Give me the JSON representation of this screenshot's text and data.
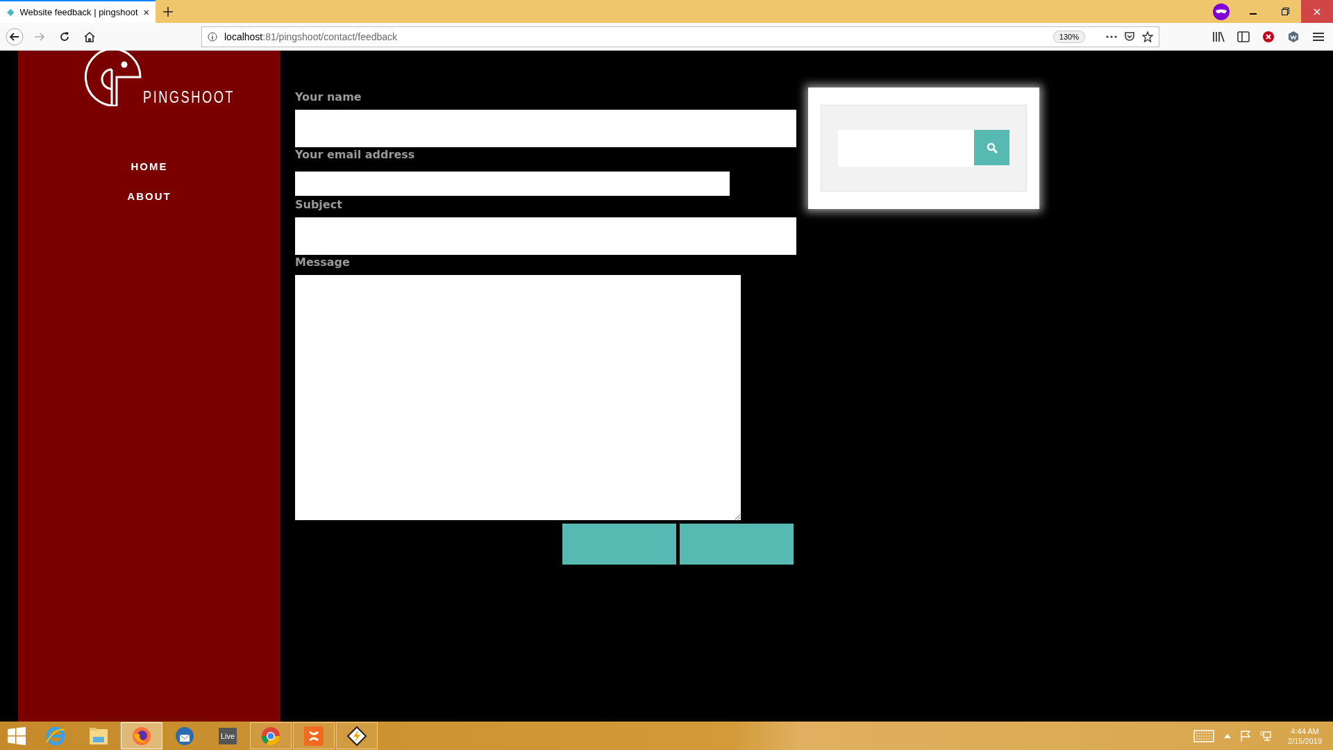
{
  "browser": {
    "tab": {
      "title": "Website feedback | pingshoot",
      "selected": true
    },
    "address": {
      "host": "localhost",
      "path": ":81/pingshoot/contact/feedback"
    },
    "zoom": "130%"
  },
  "sidebar": {
    "logo_text": "PINGSHOOT",
    "nav": [
      {
        "label": "HOME"
      },
      {
        "label": "ABOUT"
      }
    ]
  },
  "form": {
    "fields": [
      {
        "label": "Your name",
        "kind": "wide"
      },
      {
        "label": "Your email address",
        "kind": "short"
      },
      {
        "label": "Subject",
        "kind": "wide"
      },
      {
        "label": "Message",
        "kind": "textarea"
      }
    ]
  },
  "taskbar": {
    "apps": [
      {
        "kind": "ie",
        "running": false,
        "selected": false
      },
      {
        "kind": "explorer",
        "running": false,
        "selected": false
      },
      {
        "kind": "firefox",
        "running": true,
        "selected": true
      },
      {
        "kind": "thunderbird",
        "running": false,
        "selected": false
      },
      {
        "kind": "live",
        "label": "Live",
        "running": false,
        "selected": false
      },
      {
        "kind": "chrome",
        "running": true,
        "selected": false
      },
      {
        "kind": "xampp",
        "running": true,
        "selected": false
      },
      {
        "kind": "winamp",
        "running": true,
        "selected": false
      }
    ],
    "time": "4:44 AM",
    "date": "2/15/2019"
  }
}
